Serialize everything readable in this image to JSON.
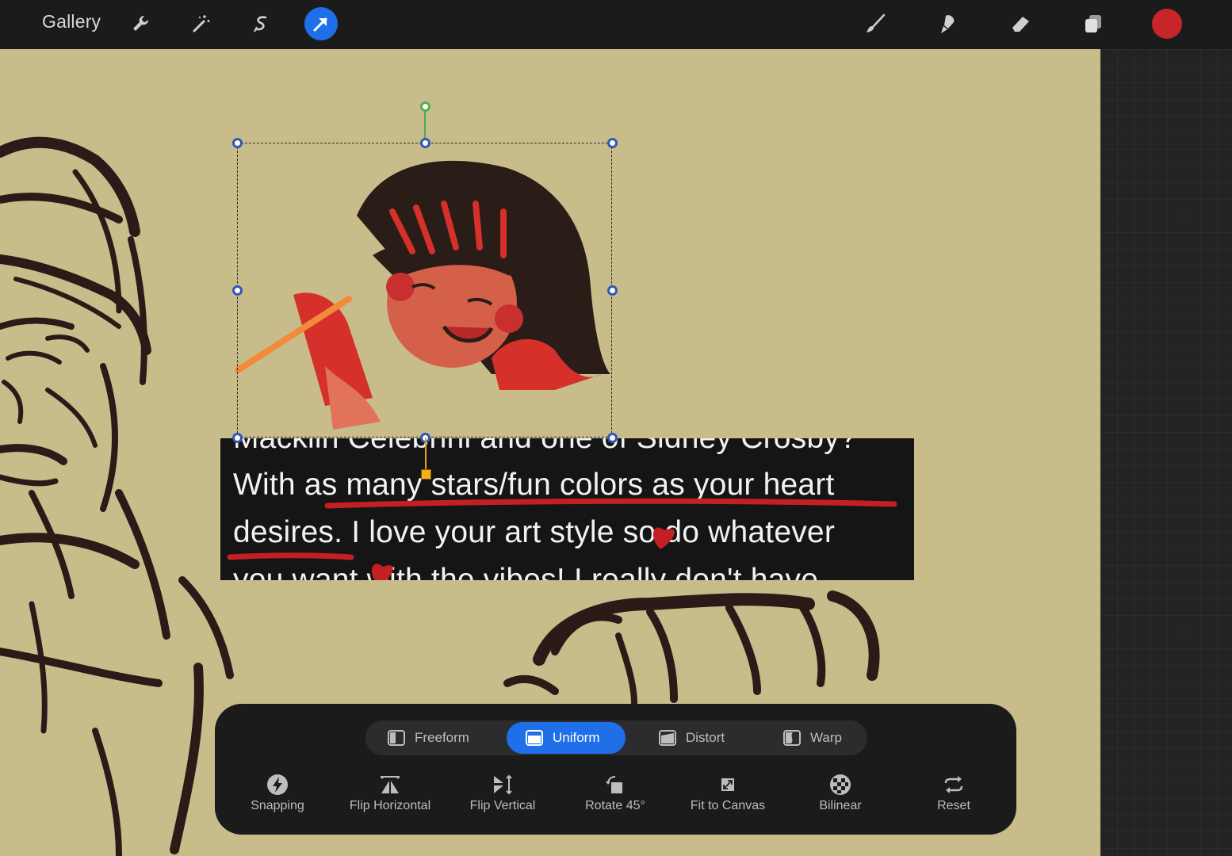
{
  "topbar": {
    "gallery_label": "Gallery",
    "tools_left": [
      "wrench-icon",
      "magic-wand-icon",
      "selection-s-icon",
      "transform-arrow-icon"
    ],
    "tools_right": [
      "brush-icon",
      "smudge-icon",
      "eraser-icon",
      "layers-icon"
    ],
    "active_tool": "transform-arrow-icon",
    "current_color": "#c8252a",
    "accent_color": "#1f6fe8"
  },
  "canvas": {
    "background_color": "#c8bd8a",
    "text_card": {
      "line1": "Macklin Celebrini and one of Sidney Crosby?",
      "line2": "With as many stars/fun colors as your heart",
      "line3": "desires. I love your art style so do whatever",
      "line4": "you want with the vibes! I really don't have"
    }
  },
  "transform_modes": [
    {
      "label": "Freeform",
      "active": false
    },
    {
      "label": "Uniform",
      "active": true
    },
    {
      "label": "Distort",
      "active": false
    },
    {
      "label": "Warp",
      "active": false
    }
  ],
  "actions": [
    {
      "label": "Snapping",
      "icon": "lightning-icon"
    },
    {
      "label": "Flip Horizontal",
      "icon": "flip-horizontal-icon"
    },
    {
      "label": "Flip Vertical",
      "icon": "flip-vertical-icon"
    },
    {
      "label": "Rotate 45°",
      "icon": "rotate-icon"
    },
    {
      "label": "Fit to Canvas",
      "icon": "fit-to-canvas-icon"
    },
    {
      "label": "Bilinear",
      "icon": "checker-sphere-icon"
    },
    {
      "label": "Reset",
      "icon": "reset-arrows-icon"
    }
  ]
}
